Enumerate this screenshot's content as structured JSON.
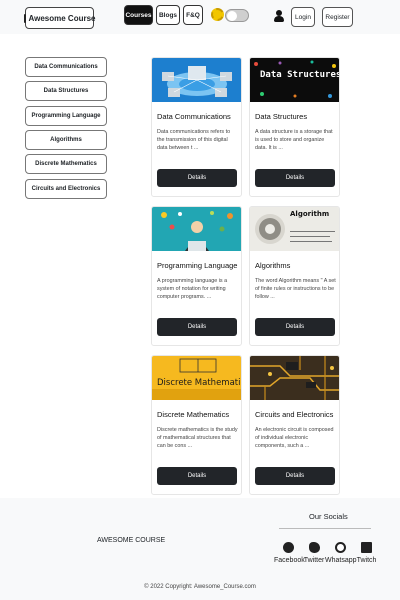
{
  "header": {
    "brand": "Awesome Course",
    "nav": [
      "Courses",
      "Blogs",
      "F&Q"
    ],
    "login": "Login",
    "register": "Register"
  },
  "sidebar": {
    "items": [
      "Data Communications",
      "Data Structures",
      "Programming Language",
      "Algorithms",
      "Discrete Mathematics",
      "Circuits and Electronics"
    ]
  },
  "cards": [
    {
      "title": "Data Communications",
      "text": "Data communications refers to the transmission of this digital data between t ...",
      "button": "Details"
    },
    {
      "title": "Data Structures",
      "text": "A data structure is a storage that is used to store and organize data. It is ...",
      "button": "Details",
      "image_text": "Data Structures"
    },
    {
      "title": "Programming Language",
      "text": "A programming language is a system of notation for writing computer programs. ...",
      "button": "Details"
    },
    {
      "title": "Algorithms",
      "text": "The word Algorithm means \" A set of finite rules or instructions to be follow ...",
      "button": "Details",
      "image_text": "Algorithm"
    },
    {
      "title": "Discrete Mathematics",
      "text": "Discrete mathematics is the study of mathematical structures that can be cons ...",
      "button": "Details",
      "image_text": "Discrete Mathematics"
    },
    {
      "title": "Circuits and Electronics",
      "text": "An electronic circuit is composed of individual electronic components, such a ...",
      "button": "Details"
    }
  ],
  "footer": {
    "brand": "AWESOME COURSE",
    "socials_title": "Our Socials",
    "socials": [
      "Facebook",
      "Twitter",
      "Whatsapp",
      "Twitch"
    ],
    "copyright": "© 2022 Copyright: Awesome_Course.com"
  },
  "colors": {
    "dark_button": "#222529",
    "toggle_sun": "#f2c600",
    "footer_bg": "#f8f9fa"
  }
}
